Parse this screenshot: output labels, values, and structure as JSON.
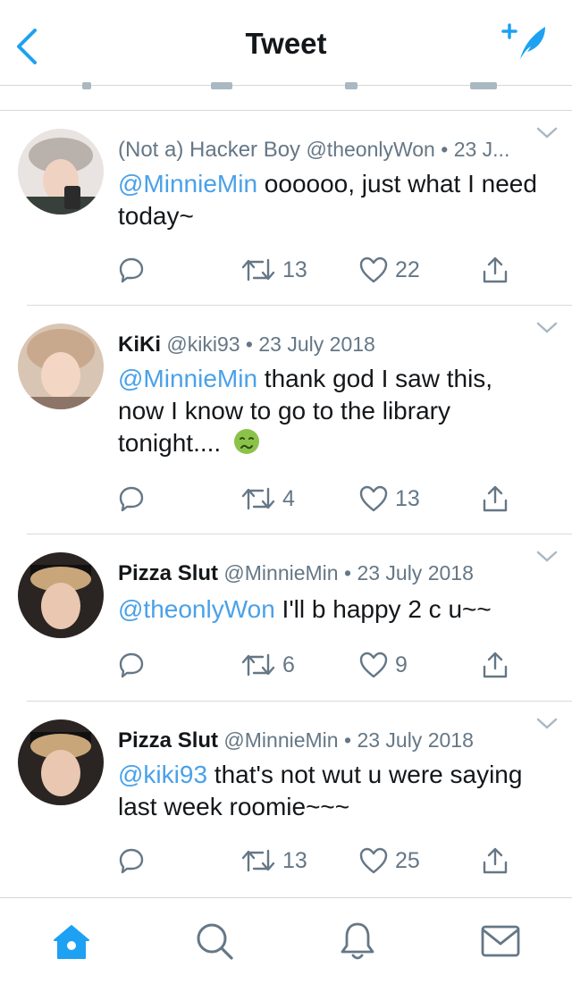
{
  "header": {
    "title": "Tweet",
    "back_icon": "chevron-left-icon",
    "compose_icon": "compose-feather-icon",
    "accent": "#1da1f2"
  },
  "tweets": [
    {
      "display_name": "(Not a) Hacker Boy",
      "handle": "@theonlyWon",
      "date": "23 J...",
      "mention": "@MinnieMin",
      "text": " oooooo, just what I need today~",
      "replies": "",
      "retweets": "13",
      "likes": "22"
    },
    {
      "display_name": "KiKi",
      "handle": "@kiki93",
      "date": "23 July 2018",
      "mention": "@MinnieMin",
      "text": " thank god I saw this, now I know to go to the library tonight....",
      "emoji": "nauseated-face-emoji",
      "replies": "",
      "retweets": "4",
      "likes": "13"
    },
    {
      "display_name": "Pizza Slut",
      "handle": "@MinnieMin",
      "date": "23 July 2018",
      "mention": "@theonlyWon",
      "text": " I'll b happy 2 c u~~",
      "replies": "",
      "retweets": "6",
      "likes": "9"
    },
    {
      "display_name": "Pizza Slut",
      "handle": "@MinnieMin",
      "date": "23 July 2018",
      "mention": "@kiki93",
      "text": " that's not wut u were saying last week roomie~~~",
      "replies": "",
      "retweets": "13",
      "likes": "25"
    }
  ],
  "separator": " • ",
  "tabbar": {
    "items": [
      "home-icon",
      "search-icon",
      "notifications-bell-icon",
      "messages-envelope-icon"
    ],
    "active_color": "#1da1f2",
    "inactive_color": "#657786"
  }
}
